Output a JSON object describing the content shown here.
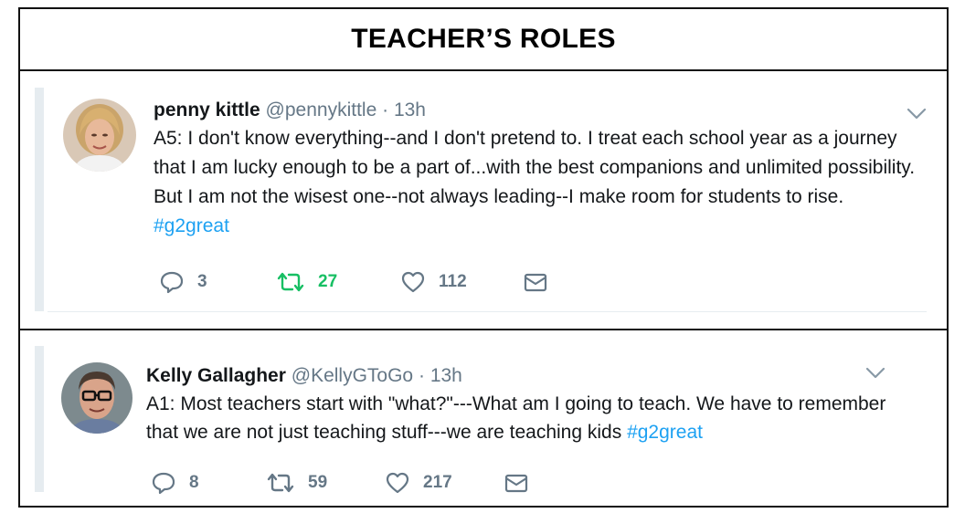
{
  "header": {
    "title": "TEACHER’S ROLES"
  },
  "colors": {
    "hashtag": "#1da1f2",
    "retweet_active": "#17bf63",
    "muted": "#657786"
  },
  "tweets": [
    {
      "name": "penny kittle",
      "handle": "@pennykittle",
      "separator": "·",
      "time": "13h",
      "text": "A5: I don't know everything--and I don't pretend to. I treat each school year as a journey that I am lucky enough to be a part of...with the best companions and unlimited possibility. But I am not the wisest one--not always leading--I make room for students to rise.",
      "hashtag": "#g2great",
      "replies": "3",
      "retweets": "27",
      "likes": "112",
      "retweeted": true
    },
    {
      "name": "Kelly Gallagher",
      "handle": "@KellyGToGo",
      "separator": "·",
      "time": "13h",
      "text": "A1: Most teachers start with \"what?\"---What am I going to teach. We have to remember that we are not just teaching stuff---we are teaching kids",
      "hashtag": "#g2great",
      "replies": "8",
      "retweets": "59",
      "likes": "217",
      "retweeted": false
    }
  ]
}
